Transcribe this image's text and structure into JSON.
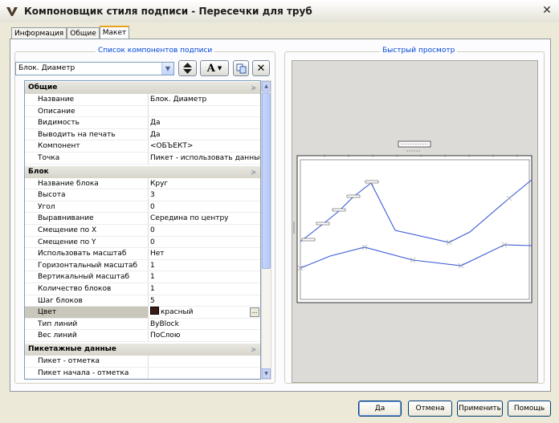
{
  "window": {
    "title": "Компоновщик стиля подписи - Пересечки для труб",
    "close_glyph": "✕"
  },
  "tabs": [
    {
      "label": "Информация",
      "active": false
    },
    {
      "label": "Общие",
      "active": false
    },
    {
      "label": "Макет",
      "active": true
    }
  ],
  "components": {
    "group_title": "Список компонентов подписи",
    "selected": "Блок. Диаметр"
  },
  "preview": {
    "group_title": "Быстрый просмотр"
  },
  "properties": {
    "categories": [
      {
        "name": "Общие",
        "rows": [
          {
            "key": "Название",
            "value": "Блок. Диаметр"
          },
          {
            "key": "Описание",
            "value": ""
          },
          {
            "key": "Видимость",
            "value": "Да"
          },
          {
            "key": "Выводить на печать",
            "value": "Да"
          },
          {
            "key": "Компонент",
            "value": "<ОБЪЕКТ>"
          },
          {
            "key": "Точка",
            "value": "Пикет - использовать данные"
          }
        ]
      },
      {
        "name": "Блок",
        "rows": [
          {
            "key": "Название блока",
            "value": "Круг"
          },
          {
            "key": "Высота",
            "value": "3"
          },
          {
            "key": "Угол",
            "value": "0"
          },
          {
            "key": "Выравнивание",
            "value": "Середина по центру"
          },
          {
            "key": "Смещение по X",
            "value": "0"
          },
          {
            "key": "Смещение по Y",
            "value": "0"
          },
          {
            "key": "Использовать масштаб",
            "value": "Нет"
          },
          {
            "key": "Горизонтальный масштаб",
            "value": "1"
          },
          {
            "key": "Вертикальный масштаб",
            "value": "1"
          },
          {
            "key": "Количество блоков",
            "value": "1"
          },
          {
            "key": "Шаг блоков",
            "value": "5"
          },
          {
            "key": "Цвет",
            "value": "красный"
          },
          {
            "key": "Тип линий",
            "value": "ByBlock"
          },
          {
            "key": "Вес линий",
            "value": "ПоСлою"
          }
        ]
      },
      {
        "name": "Пикетажные данные",
        "rows": [
          {
            "key": "Пикет - отметка",
            "value": ""
          },
          {
            "key": "Пикет начала - отметка",
            "value": ""
          }
        ]
      }
    ]
  },
  "buttons": {
    "ok": "Да",
    "cancel": "Отмена",
    "apply": "Применить",
    "help": "Помощь"
  },
  "colors": {
    "swatch": "#3a1c17",
    "line": "#3b5bd6",
    "group_title": "#0046d5"
  }
}
